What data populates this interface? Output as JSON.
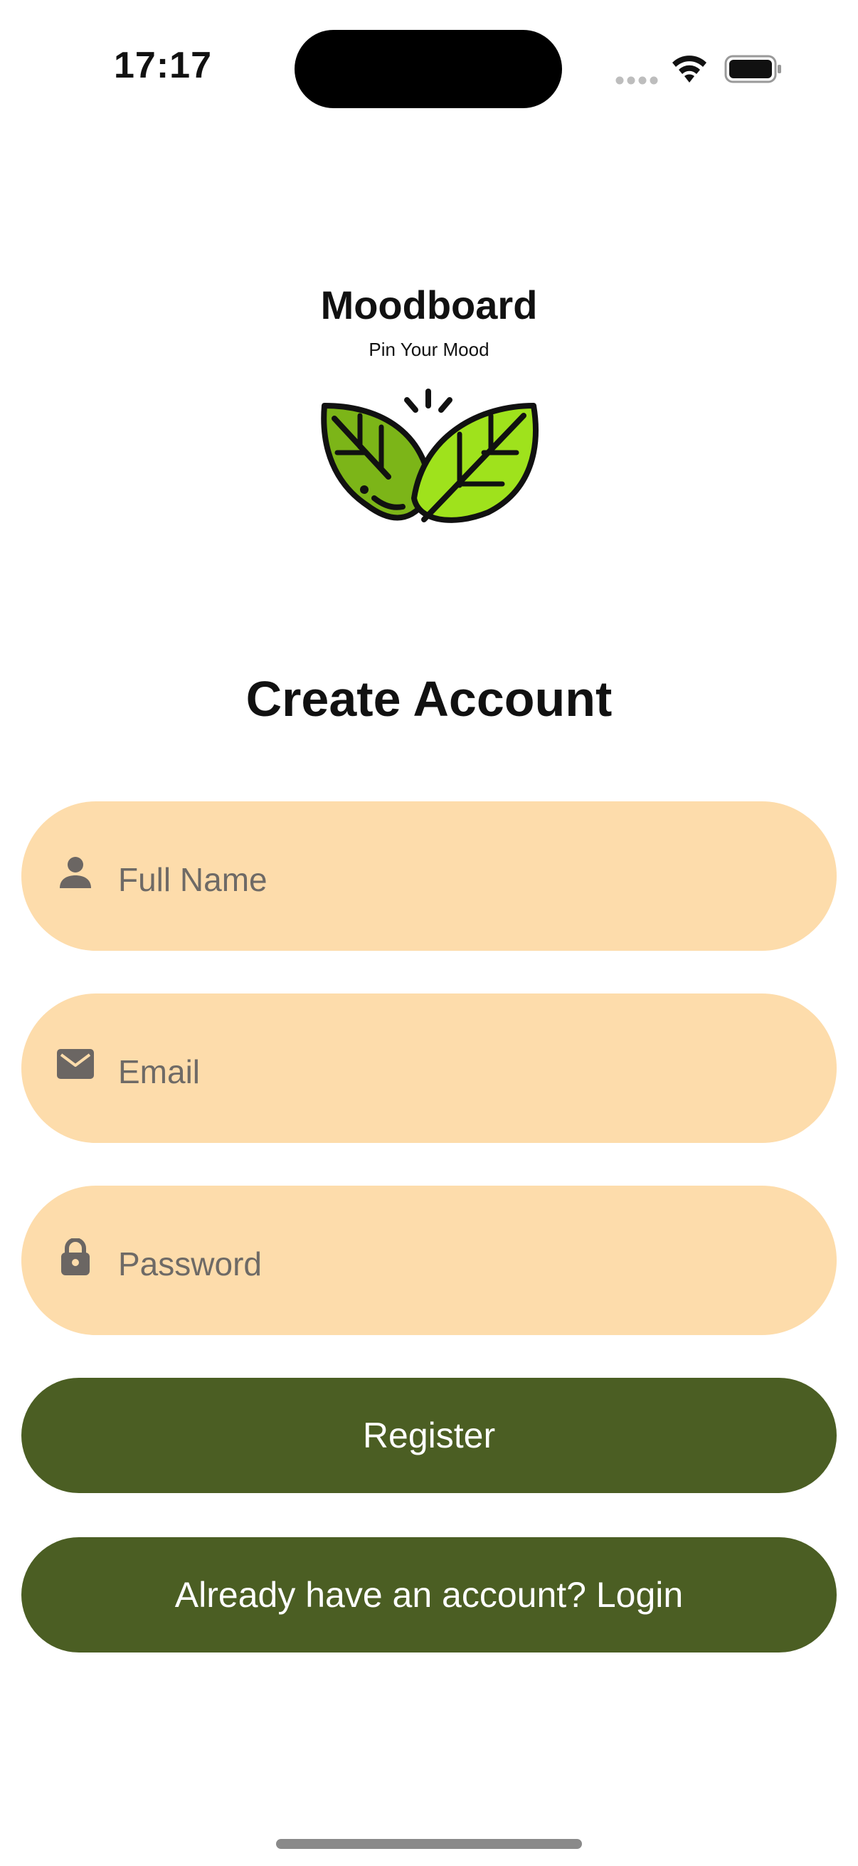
{
  "status_bar": {
    "time": "17:17",
    "icons": [
      "signal-icon",
      "wifi-icon",
      "battery-icon"
    ]
  },
  "brand": {
    "title": "Moodboard",
    "tagline": "Pin Your Mood",
    "logo_icon": "leaves-icon"
  },
  "page": {
    "title": "Create Account"
  },
  "form": {
    "full_name": {
      "placeholder": "Full Name",
      "value": "",
      "icon": "person-icon"
    },
    "email": {
      "placeholder": "Email",
      "value": "",
      "icon": "envelope-icon"
    },
    "password": {
      "placeholder": "Password",
      "value": "",
      "icon": "lock-icon"
    }
  },
  "actions": {
    "register_label": "Register",
    "login_label": "Already have an account? Login"
  },
  "colors": {
    "field_bg": "#fddcab",
    "button_bg": "#4b5e23",
    "button_text": "#ffffff",
    "leaf_light": "#9fe21c",
    "leaf_dark": "#7cb518"
  }
}
